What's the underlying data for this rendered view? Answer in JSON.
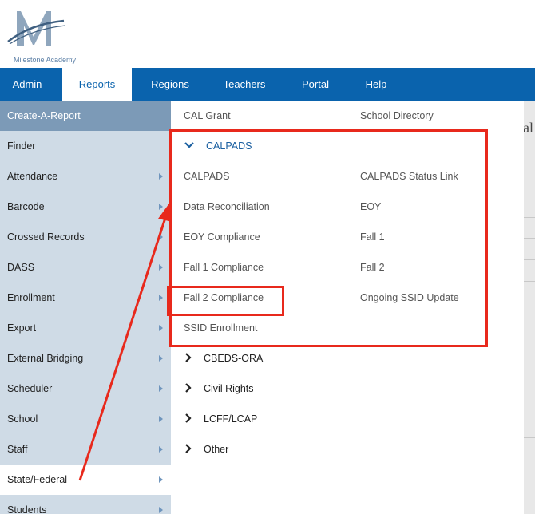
{
  "logo": {
    "text": "Milestone Academy"
  },
  "topnav": {
    "items": [
      {
        "label": "Admin"
      },
      {
        "label": "Reports"
      },
      {
        "label": "Regions"
      },
      {
        "label": "Teachers"
      },
      {
        "label": "Portal"
      },
      {
        "label": "Help"
      }
    ],
    "active": "Reports"
  },
  "sidebar": {
    "items": [
      {
        "label": "Create-A-Report"
      },
      {
        "label": "Finder"
      },
      {
        "label": "Attendance"
      },
      {
        "label": "Barcode"
      },
      {
        "label": "Crossed Records"
      },
      {
        "label": "DASS"
      },
      {
        "label": "Enrollment"
      },
      {
        "label": "Export"
      },
      {
        "label": "External Bridging"
      },
      {
        "label": "Scheduler"
      },
      {
        "label": "School"
      },
      {
        "label": "Staff"
      },
      {
        "label": "State/Federal"
      },
      {
        "label": "Students"
      }
    ],
    "selected": "State/Federal"
  },
  "panel": {
    "top_links": [
      "CAL Grant",
      "School Directory"
    ],
    "calpads": {
      "label": "CALPADS",
      "left": [
        "CALPADS",
        "Data Reconciliation",
        "EOY Compliance",
        "Fall 1 Compliance",
        "Fall 2 Compliance",
        "SSID Enrollment"
      ],
      "right": [
        "CALPADS Status Link",
        "EOY",
        "Fall 1",
        "Fall 2",
        "Ongoing SSID Update"
      ]
    },
    "groups": [
      "CBEDS-ORA",
      "Civil Rights",
      "LCFF/LCAP",
      "Other"
    ]
  },
  "background": {
    "partial_text": "al"
  },
  "colors": {
    "nav": "#0a63ad",
    "sidebar": "#cfdbe6",
    "sidebar_header": "#7c9ab7",
    "annotation": "#e8291c"
  }
}
